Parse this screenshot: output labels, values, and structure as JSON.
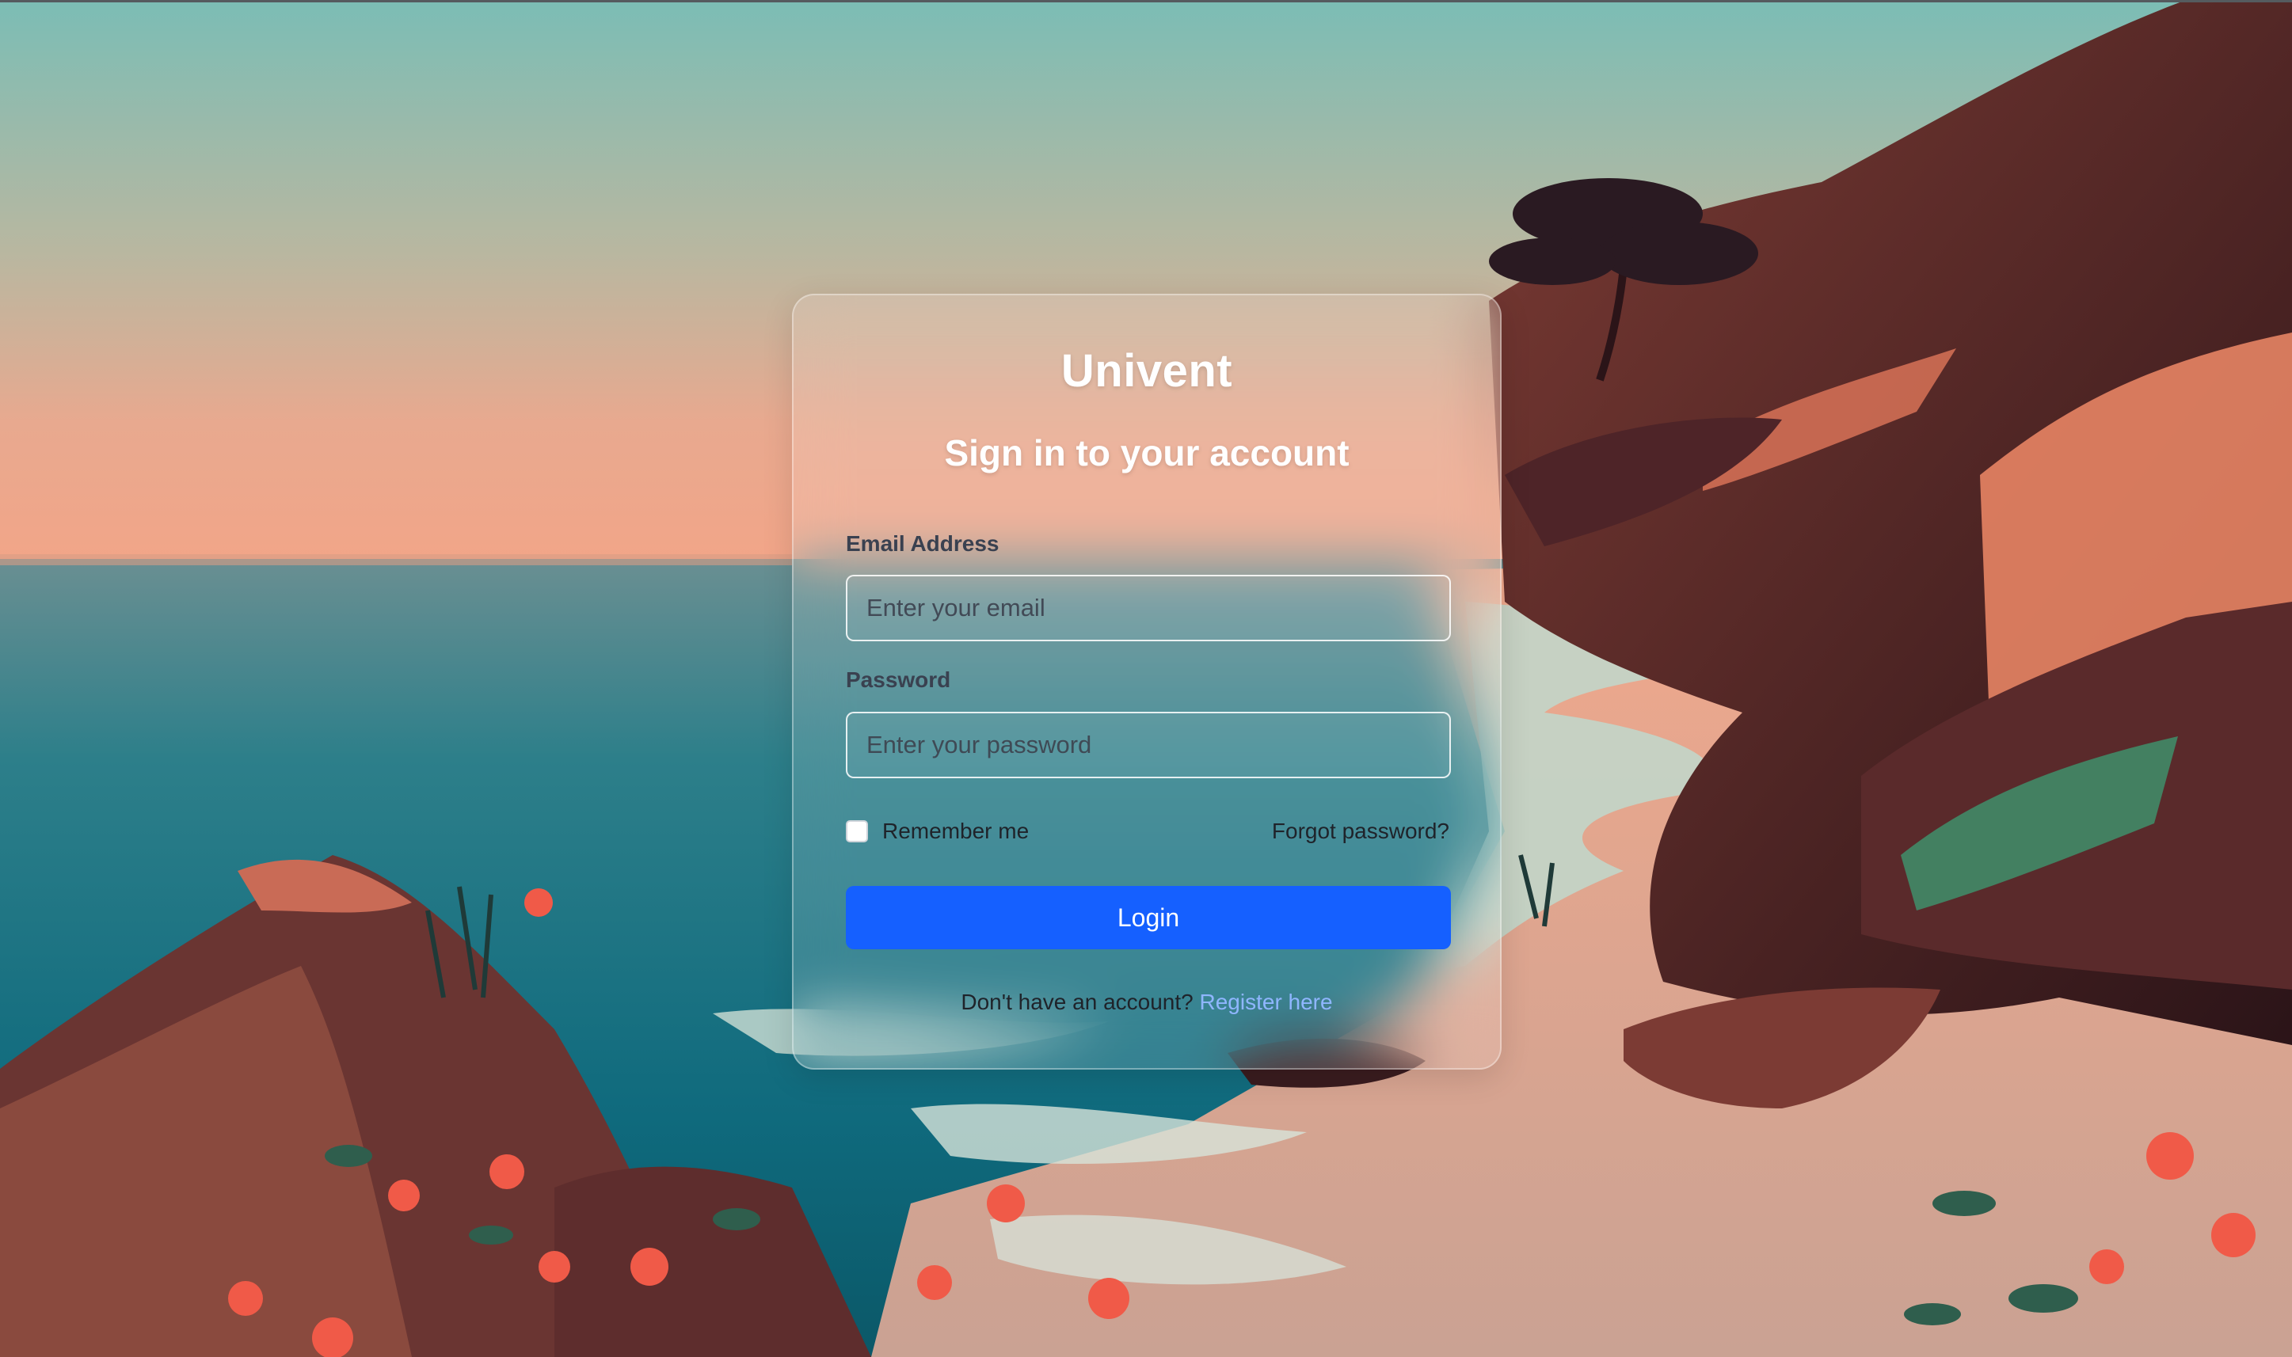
{
  "login": {
    "brand": "Univent",
    "subtitle": "Sign in to your account",
    "email_label": "Email Address",
    "email_placeholder": "Enter your email",
    "email_value": "",
    "password_label": "Password",
    "password_placeholder": "Enter your password",
    "password_value": "",
    "remember_label": "Remember me",
    "remember_checked": false,
    "forgot_label": "Forgot password?",
    "login_button": "Login",
    "register_prompt": "Don't have an account?",
    "register_link": "Register here"
  },
  "colors": {
    "accent": "#1560ff",
    "link": "#8fb6ff"
  }
}
